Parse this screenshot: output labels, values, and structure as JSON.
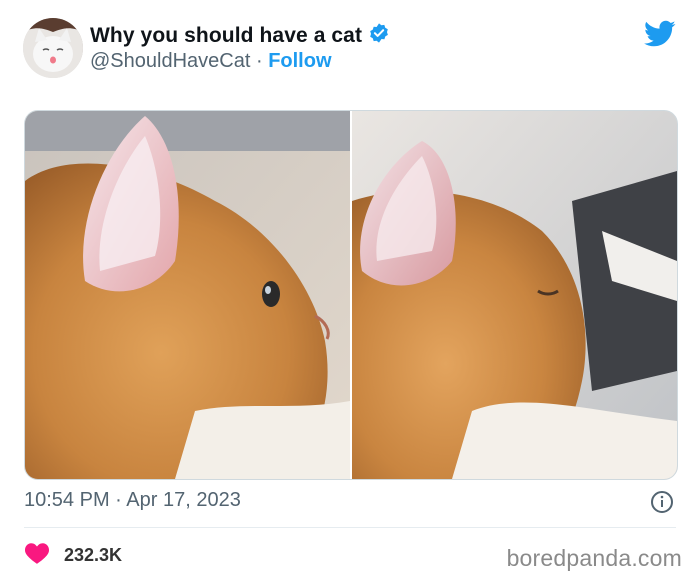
{
  "tweet": {
    "display_name": "Why you should have a cat",
    "handle": "@ShouldHaveCat",
    "separator": "·",
    "follow_label": "Follow",
    "verified_icon": "verified-badge-icon",
    "brand_icon": "twitter-bird-icon",
    "timestamp_time": "10:54 PM",
    "timestamp_date": "Apr 17, 2023",
    "like_count": "232.3K",
    "like_icon": "heart-icon",
    "info_icon": "info-circle-icon"
  },
  "media": {
    "images": [
      "cat-ear-eye-open",
      "cat-ear-eye-closed"
    ]
  },
  "watermark": "boredpanda.com",
  "colors": {
    "accent": "#1d9bf0",
    "heart": "#f91880",
    "secondary_text": "#536471",
    "cat_fur": "#d9924a"
  }
}
